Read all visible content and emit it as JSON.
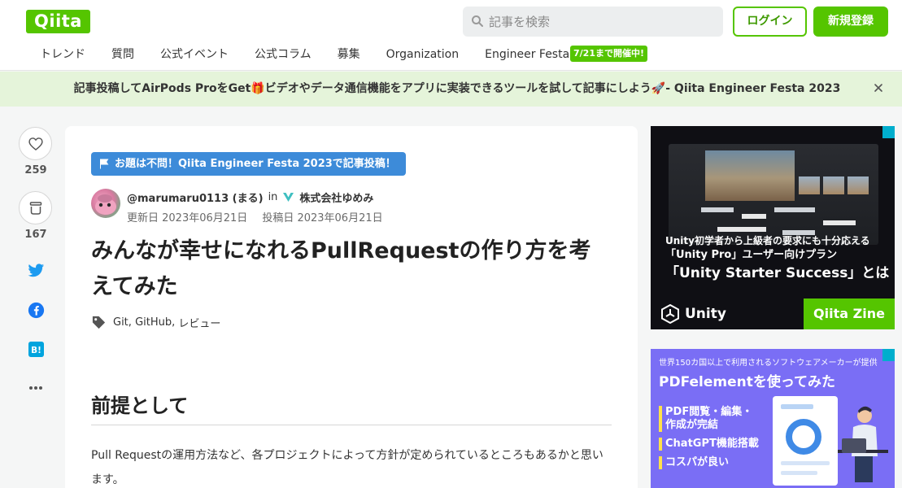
{
  "header": {
    "logo_text": "Qiita",
    "search_placeholder": "記事を検索",
    "login_label": "ログイン",
    "signup_label": "新規登録",
    "brand_color": "#55c500"
  },
  "nav": {
    "items": [
      "トレンド",
      "質問",
      "公式イベント",
      "公式コラム",
      "募集",
      "Organization",
      "Engineer Festa"
    ],
    "badge": "7/21まで開催中!"
  },
  "banner": {
    "text": "記事投稿してAirPods ProをGet🎁ビデオやデータ通信機能をアプリに実装できるツールを試して記事にしよう🚀- Qiita Engineer Festa 2023",
    "close_icon": "close-icon"
  },
  "actions": {
    "like_count": "259",
    "stock_count": "167",
    "icons": [
      "heart-icon",
      "stock-icon",
      "twitter-icon",
      "facebook-icon",
      "hatena-bookmark-icon",
      "more-icon"
    ]
  },
  "article": {
    "event_tag": "お題は不問！Qiita Engineer Festa 2023で記事投稿！",
    "author": "@marumaru0113 (まる)",
    "in": "in",
    "organization": "株式会社ゆめみ",
    "updated": "更新日 2023年06月21日",
    "posted": "投稿日 2023年06月21日",
    "title": "みんなが幸せになれるPullRequestの作り方を考えてみた",
    "tags": [
      "Git",
      "GitHub",
      "レビュー"
    ],
    "heading": "前提として",
    "paragraph": "Pull Requestの運用方法など、各プロジェクトによって方針が定められているところもあるかと思います。"
  },
  "ads": {
    "ad1": {
      "line1": "Unity初学者から上級者の要求にも十分応える",
      "line2": "「Unity Pro」ユーザー向けプラン",
      "line3": "「Unity Starter Success」とは",
      "footer_left": "Unity",
      "footer_right": "Qiita Zine"
    },
    "ad2": {
      "small": "世界150カ国以上で利用されるソフトウェアメーカーが提供",
      "title": "PDFelementを使ってみた",
      "bullets": [
        "PDF閲覧・編集・作成が完結",
        "ChatGPT機能搭載",
        "コスパが良い"
      ]
    }
  }
}
